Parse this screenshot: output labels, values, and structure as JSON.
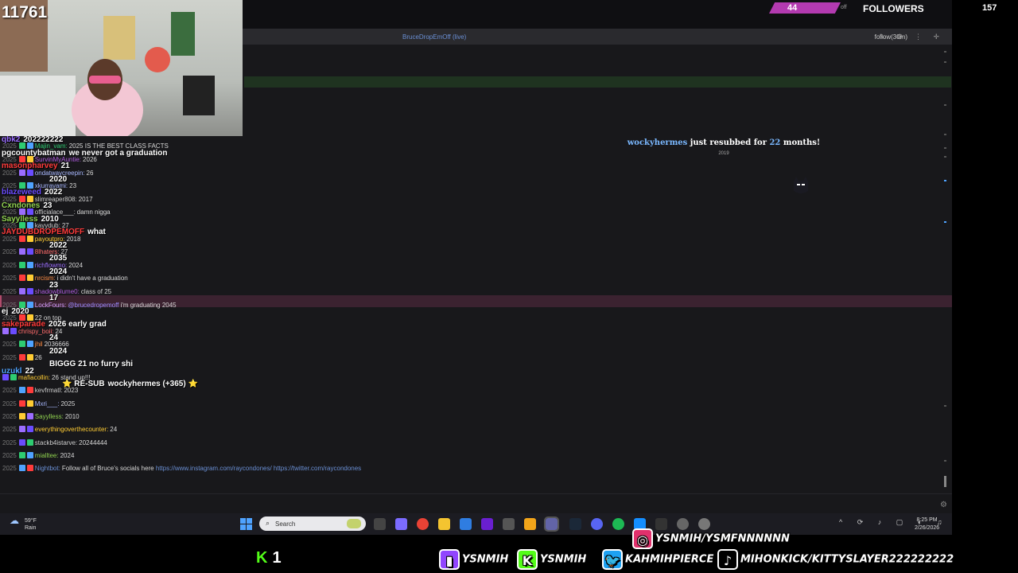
{
  "webcam": {
    "viewer_count": "11761"
  },
  "follower_goal": {
    "current": "44",
    "label": "FOLLOWERS",
    "total": "157",
    "obscured_text": "off"
  },
  "tab": {
    "title": "BruceDropEmOff (live)",
    "mode": "follow(30m)"
  },
  "resub": {
    "user": "wockyhermes",
    "text_before": "just resubbed for",
    "months": "22",
    "text_after": "months!",
    "year": "2019"
  },
  "chat": [
    {
      "ts": "",
      "user": "qbk2",
      "text": "202222222",
      "big": true,
      "color": "#9b6dff"
    },
    {
      "ts": "2025",
      "user": "Majin_vam:",
      "text": "2025 IS THE BEST CLASS FACTS",
      "color": "#2ecc71"
    },
    {
      "ts": "",
      "user": "pgcountybatman",
      "text": "we never got a graduation",
      "big": true,
      "color": "#ffffff"
    },
    {
      "ts": "2025",
      "user": "SurvinMyAuntie:",
      "text": "2026",
      "color": "#b05ce0"
    },
    {
      "ts": "",
      "user": "masonpharvey",
      "text": "21",
      "big": true,
      "color": "#ff3b3b"
    },
    {
      "ts": "2025",
      "user": "ondatwaycreepin:",
      "text": "26",
      "color": "#a8b8ff"
    },
    {
      "ts": "",
      "user": "",
      "text": "2020",
      "big": true,
      "color": "#ffffff"
    },
    {
      "ts": "2025",
      "user": "xkurrayami:",
      "text": "23",
      "color": "#a8b8ff"
    },
    {
      "ts": "",
      "user": "blazeweed",
      "text": "2022",
      "big": true,
      "color": "#6a4cff"
    },
    {
      "ts": "2025",
      "user": "slimreaper808:",
      "text": "2017",
      "color": "#cccccc"
    },
    {
      "ts": "",
      "user": "Cxndones",
      "text": "23",
      "big": true,
      "color": "#8fd14f"
    },
    {
      "ts": "2025",
      "user": "officialace___:",
      "text": "damn nigga",
      "color": "#cccccc"
    },
    {
      "ts": "",
      "user": "Sayylless",
      "text": "2010",
      "big": true,
      "color": "#8fd14f"
    },
    {
      "ts": "2025",
      "user": "kayydub:",
      "text": "27",
      "color": "#cccccc"
    },
    {
      "ts": "",
      "user": "JAYDUBDROPEMOFF",
      "text": "what",
      "big": true,
      "color": "#ff3b3b"
    },
    {
      "ts": "2025",
      "user": "payoutpro:",
      "text": "2018",
      "color": "#ffcc33"
    },
    {
      "ts": "",
      "user": "",
      "text": "2022",
      "big": true,
      "color": "#ffffff"
    },
    {
      "ts": "2025",
      "user": "8lhaters:",
      "text": "27",
      "color": "#ff6b6b"
    },
    {
      "ts": "",
      "user": "",
      "text": "2035",
      "big": true,
      "color": "#ffffff"
    },
    {
      "ts": "2025",
      "user": "richflowmo:",
      "text": "2024",
      "color": "#9b6dff"
    },
    {
      "ts": "",
      "user": "",
      "text": "2024",
      "big": true,
      "color": "#ffffff"
    },
    {
      "ts": "2025",
      "user": "nrcism:",
      "text": "i didn't have a graduation",
      "color": "#ff8c42"
    },
    {
      "ts": "",
      "user": "",
      "text": "23",
      "big": true,
      "color": "#ffffff"
    },
    {
      "ts": "2025",
      "user": "shadowblume0:",
      "text": "class of 25",
      "color": "#b05ce0"
    },
    {
      "ts": "",
      "user": "",
      "text": "17",
      "big": true,
      "color": "#ffffff"
    },
    {
      "ts": "2025",
      "user": "LockFours:",
      "text": "@brucedropemoff i'm graduating 2045",
      "color": "#d4a0ff",
      "mention": "@brucedropemoff",
      "highlight": true
    },
    {
      "ts": "",
      "user": "ej",
      "text": "2020",
      "big": true,
      "color": "#ffffff"
    },
    {
      "ts": "2025",
      "user": "",
      "text": "22 on top",
      "color": "#cccccc"
    },
    {
      "ts": "",
      "user": "sakeparade",
      "text": "2026 early grad",
      "big": true,
      "color": "#ff3b3b"
    },
    {
      "ts": "",
      "user": "chrispy_boii:",
      "text": "24",
      "color": "#ff6b6b"
    },
    {
      "ts": "",
      "user": "",
      "text": "24",
      "big": true,
      "color": "#ffffff"
    },
    {
      "ts": "2025",
      "user": "jhil",
      "text": "2036666",
      "color": "#ff8c42"
    },
    {
      "ts": "",
      "user": "",
      "text": "2024",
      "big": true,
      "color": "#ffffff"
    },
    {
      "ts": "2025",
      "user": "",
      "text": "26",
      "color": "#cccccc"
    },
    {
      "ts": "",
      "user": "",
      "text": "BIGGG 21 no furry shi",
      "big": true,
      "color": "#ffffff"
    },
    {
      "ts": "",
      "user": "uzukl",
      "text": "22",
      "big": true,
      "color": "#4fa3ff"
    },
    {
      "ts": "",
      "user": "mafiacollin:",
      "text": "26 stand up!!!",
      "color": "#ffcc33"
    },
    {
      "ts": "",
      "user": "RE-SUB",
      "text": "wockyhermes (+365)",
      "big": true,
      "color": "#ffffff",
      "stars": true
    },
    {
      "ts": "2025",
      "user": "kevfrmatl:",
      "text": "2023",
      "color": "#cccccc"
    },
    {
      "ts": "2025",
      "user": "Mxri___:",
      "text": "2025",
      "color": "#a8b8ff"
    },
    {
      "ts": "2025",
      "user": "Sayylless:",
      "text": "2010",
      "color": "#8fd14f"
    },
    {
      "ts": "2025",
      "user": "everythingoverthecounter:",
      "text": "24",
      "color": "#ffcc33"
    },
    {
      "ts": "2025",
      "user": "stackb4istarve:",
      "text": "20244444",
      "color": "#cccccc"
    },
    {
      "ts": "2025",
      "user": "mialltee:",
      "text": "2024",
      "color": "#8fd14f"
    },
    {
      "ts": "2025",
      "user": "Nightbot:",
      "text": "Follow all of Bruce's socials here",
      "color": "#6a8fd4",
      "links": "https://www.instagram.com/raycondones/ https://twitter.com/raycondones"
    }
  ],
  "taskbar": {
    "temp": "59°F",
    "condition": "Rain",
    "search_placeholder": "Search",
    "time": "8:25 PM",
    "date": "2/26/2026"
  },
  "overlay": {
    "kick_viewers": "1",
    "socials": [
      {
        "platform": "instagram-icon",
        "handle": "YSNMIH/YSMFNNNNNN",
        "color": "#e1306c"
      },
      {
        "platform": "twitch-icon",
        "handle": "YSNMIH",
        "color": "#9146ff"
      },
      {
        "platform": "kick-icon",
        "handle": "YSNMIH",
        "color": "#53fc18"
      },
      {
        "platform": "twitter-icon",
        "handle": "KAHMIHPIERCE",
        "color": "#1da1f2"
      },
      {
        "platform": "tiktok-icon",
        "handle": "MIHONKICK/KITTYSLAYER222222222",
        "color": "#000000"
      }
    ]
  },
  "colors": {
    "accent": "#b33ab0",
    "chat_bg": "#18181b",
    "highlight": "#3b2230"
  }
}
